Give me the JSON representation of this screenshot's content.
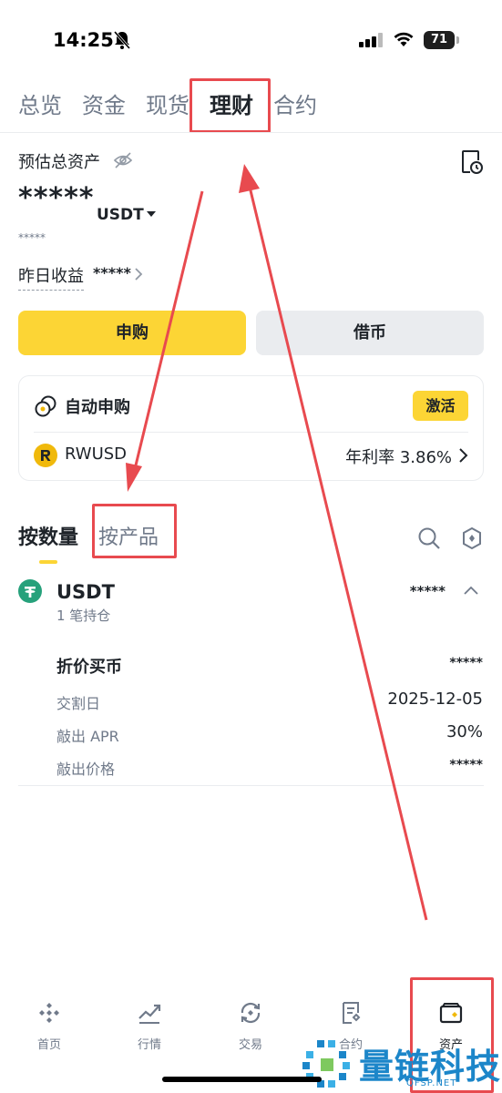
{
  "status_bar": {
    "time": "14:25",
    "battery": "71"
  },
  "top_tabs": [
    {
      "label": "总览"
    },
    {
      "label": "资金"
    },
    {
      "label": "现货"
    },
    {
      "label": "理财",
      "active": true
    },
    {
      "label": "合约"
    }
  ],
  "assets": {
    "label": "预估总资产",
    "total_value": "*****",
    "unit": "USDT",
    "sub_value": "*****",
    "yesterday_label": "昨日收益",
    "yesterday_value": "*****"
  },
  "actions": {
    "subscribe": "申购",
    "borrow": "借币"
  },
  "auto_subscribe": {
    "title": "自动申购",
    "activate": "激活",
    "coin": "RWUSD",
    "apr": "年利率 3.86%"
  },
  "sub_tabs": [
    {
      "label": "按数量",
      "active": true
    },
    {
      "label": "按产品"
    }
  ],
  "position": {
    "name": "USDT",
    "count": "1 笔持仓",
    "value": "*****",
    "detail_title": "折价买币",
    "detail_title_value": "*****",
    "rows": [
      {
        "label": "交割日",
        "value": "2025-12-05"
      },
      {
        "label": "敲出 APR",
        "value": "30%"
      },
      {
        "label": "敲出价格",
        "value": "*****"
      }
    ]
  },
  "bottom_nav": [
    {
      "label": "首页",
      "icon": "home-diamond-icon"
    },
    {
      "label": "行情",
      "icon": "chart-trend-icon"
    },
    {
      "label": "交易",
      "icon": "exchange-icon"
    },
    {
      "label": "合约",
      "icon": "document-icon"
    },
    {
      "label": "资产",
      "icon": "wallet-icon",
      "active": true
    }
  ],
  "watermark": {
    "text": "量链科技",
    "sub": "QFSP.NET"
  },
  "colors": {
    "brand_yellow": "#fcd535",
    "annotation_red": "#e84a4f",
    "text_primary": "#1e2329",
    "text_secondary": "#707a8a"
  }
}
